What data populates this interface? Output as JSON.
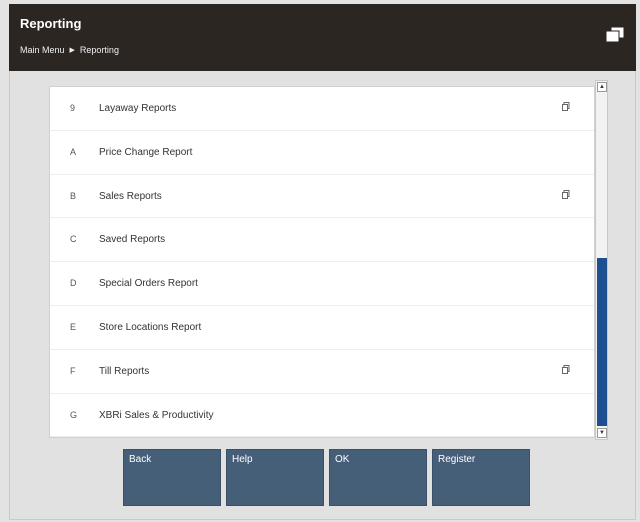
{
  "header": {
    "title": "Reporting",
    "breadcrumb": [
      "Main Menu",
      "Reporting"
    ]
  },
  "menu_items": [
    {
      "key": "9",
      "label": "Layaway Reports",
      "has_submenu": true
    },
    {
      "key": "A",
      "label": "Price Change Report",
      "has_submenu": false
    },
    {
      "key": "B",
      "label": "Sales Reports",
      "has_submenu": true
    },
    {
      "key": "C",
      "label": "Saved Reports",
      "has_submenu": false
    },
    {
      "key": "D",
      "label": "Special Orders Report",
      "has_submenu": false
    },
    {
      "key": "E",
      "label": "Store Locations Report",
      "has_submenu": false
    },
    {
      "key": "F",
      "label": "Till Reports",
      "has_submenu": true
    },
    {
      "key": "G",
      "label": "XBRi Sales & Productivity",
      "has_submenu": false
    }
  ],
  "buttons": [
    "Back",
    "Help",
    "OK",
    "Register"
  ],
  "colors": {
    "header_bg": "#2c2623",
    "button_bg": "#465f79",
    "scroll_thumb": "#1d4f91"
  }
}
